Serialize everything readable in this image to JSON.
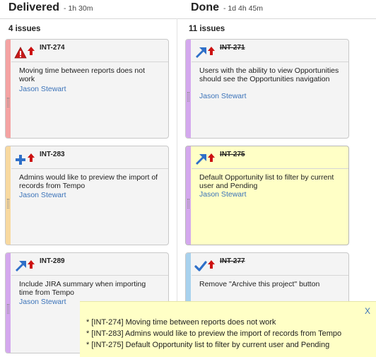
{
  "columns": [
    {
      "title": "Delivered",
      "duration": "- 1h 30m",
      "count": "4 issues"
    },
    {
      "title": "Done",
      "duration": "- 1d 4h 45m",
      "count": "11 issues"
    }
  ],
  "cards": {
    "int274": {
      "key": "INT-274",
      "summary": "Moving time between reports does not work",
      "assignee": "Jason Stewart",
      "type_icon": "error-triangle-icon",
      "stripe_color": "#f4a3a3"
    },
    "int283": {
      "key": "INT-283",
      "summary": "Admins would like to preview the import of records from Tempo",
      "assignee": "Jason Stewart",
      "type_icon": "plus-icon",
      "stripe_color": "#f8d9a0"
    },
    "int289": {
      "key": "INT-289",
      "summary": "Include JIRA summary when importing time from Tempo",
      "assignee": "Jason Stewart",
      "type_icon": "improvement-arrow-icon",
      "stripe_color": "#d4a8ee"
    },
    "int271": {
      "key": "INT-271",
      "summary": "Users with the ability to view Opportunities should see the Opportunities navigation",
      "assignee": "Jason Stewart",
      "type_icon": "improvement-arrow-icon",
      "stripe_color": "#d4a8ee"
    },
    "int275": {
      "key": "INT-275",
      "summary": "Default Opportunity list to filter by current user and Pending",
      "assignee": "Jason Stewart",
      "type_icon": "improvement-arrow-icon",
      "stripe_color": "#d4a8ee"
    },
    "int277": {
      "key": "INT-277",
      "summary": "Remove \"Archive this project\" button",
      "assignee": "",
      "type_icon": "checkmark-icon",
      "stripe_color": "#a8d2ee"
    }
  },
  "notice": {
    "close_label": "X",
    "lines": [
      "* [INT-274] Moving time between reports does not work",
      "* [INT-283] Admins would like to preview the import of records from Tempo",
      "* [INT-275] Default Opportunity list to filter by current user and Pending"
    ]
  },
  "colors": {
    "link": "#3b73b9",
    "highlight": "#ffffc6",
    "priority_arrow": "#cc1111"
  }
}
